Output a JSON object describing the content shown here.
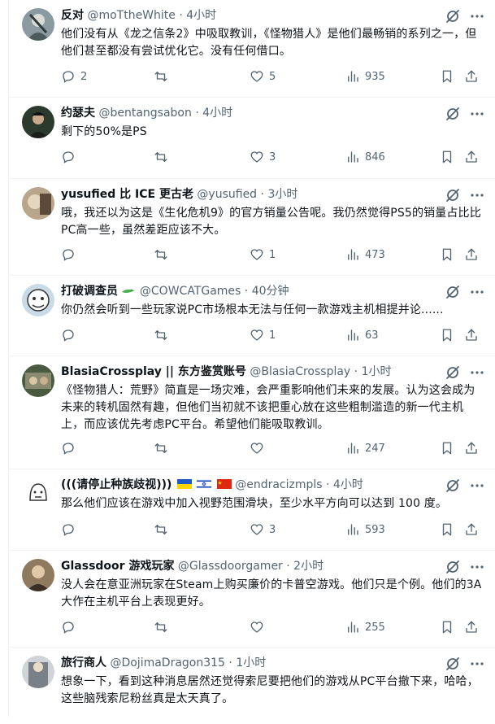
{
  "tweets": [
    {
      "name": "反对",
      "handle": "@moTtheWhite",
      "time": "4小时",
      "text": "他们没有从《龙之信条2》中吸取教训，《怪物猎人》是他们最畅销的系列之一，但他们甚至都没有尝试优化它。没有任何借口。",
      "replies": "2",
      "retweets": "",
      "likes": "5",
      "views": "935",
      "avatar_color": "#8a9aa0"
    },
    {
      "name": "约瑟夫",
      "handle": "@bentangsabon",
      "time": "4小时",
      "text": "剩下的50%是PS",
      "replies": "",
      "retweets": "",
      "likes": "3",
      "views": "846",
      "avatar_color": "#2b3a2c"
    },
    {
      "name": "yusufied 比 ICE 更古老",
      "handle": "@yusufied",
      "time": "3小时",
      "text": "哦，我还以为这是《生化危机9》的官方销量公告呢。我仍然觉得PS5的销量占比比PC高一些，虽然差距应该不大。",
      "replies": "",
      "retweets": "",
      "likes": "1",
      "views": "473",
      "avatar_color": "#b8a58a"
    },
    {
      "name": "打破调查员",
      "name_emoji": "crocodile-emoji",
      "handle": "@COWCATGames",
      "time": "40分钟",
      "text": "你仍然会听到一些玩家说PC市场根本无法与任何一款游戏主机相提并论......",
      "replies": "",
      "retweets": "",
      "likes": "1",
      "views": "63",
      "avatar_color": "#c9dbe6"
    },
    {
      "name": "BlasiaCrossplay || 东方鉴赏账号",
      "handle": "@BlasiaCrossplay",
      "time": "1小时",
      "text": "《怪物猎人：荒野》简直是一场灾难，会严重影响他们未来的发展。认为这会成为未来的转机固然有趣，但他们当初就不该把重心放在这些粗制滥造的新一代主机上，而应该优先考虑PC平台。希望他们能吸取教训。",
      "replies": "",
      "retweets": "",
      "likes": "",
      "views": "247",
      "avatar_color": "#4a5a40"
    },
    {
      "name": "(((请停止种族歧视)))",
      "flags": [
        "ukraine-flag",
        "israel-flag",
        "china-flag"
      ],
      "handle": "@endracizmpls",
      "time": "4小时",
      "text": "那么他们应该在游戏中加入视野范围滑块，至少水平方向可以达到 100 度。",
      "replies": "",
      "retweets": "",
      "likes": "3",
      "views": "593",
      "avatar_color": "#ffffff"
    },
    {
      "name": "Glassdoor 游戏玩家",
      "handle": "@Glassdoorgamer",
      "time": "2小时",
      "text": "没人会在意亚洲玩家在Steam上购买廉价的卡普空游戏。他们只是个例。他们的3A大作在主机平台上表现更好。",
      "replies": "",
      "retweets": "",
      "likes": "",
      "views": "255",
      "avatar_color": "#8f7a60"
    },
    {
      "name": "旅行商人",
      "handle": "@DojimaDragon315",
      "time": "1小时",
      "text": "想象一下，看到这种消息居然还觉得索尼要把他们的游戏从PC平台撤下来，哈哈，这些脑残索尼粉丝真是太天真了。",
      "replies": "",
      "retweets": "",
      "likes": "",
      "views": "",
      "avatar_color": "#d0d4d8"
    }
  ],
  "separator": "·",
  "icons": {
    "reply": "reply-icon",
    "retweet": "retweet-icon",
    "like": "heart-icon",
    "views": "views-icon",
    "bookmark": "bookmark-icon",
    "share": "share-icon",
    "grok": "grok-icon",
    "more": "more-icon"
  },
  "colors": {
    "text": "#0f1419",
    "secondary": "#536471",
    "border": "#eff3f4"
  }
}
